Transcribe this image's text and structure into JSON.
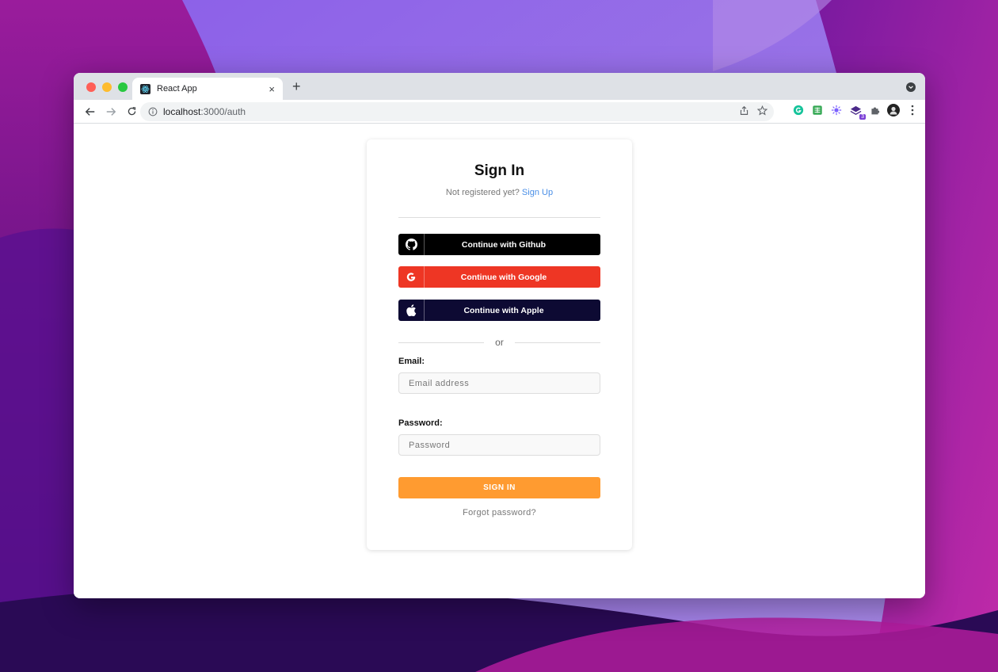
{
  "browser": {
    "tab_title": "React App",
    "tab_close": "×",
    "new_tab": "+",
    "url_host": "localhost",
    "url_path": ":3000/auth",
    "extension_badge": "3"
  },
  "auth": {
    "title": "Sign In",
    "subtitle_prefix": "Not registered yet?",
    "signup_link": "Sign Up",
    "github_label": "Continue with Github",
    "google_label": "Continue with Google",
    "apple_label": "Continue with Apple",
    "divider_text": "or",
    "email_label": "Email:",
    "email_placeholder": "Email address",
    "password_label": "Password:",
    "password_placeholder": "Password",
    "signin_label": "SIGN IN",
    "forgot_label": "Forgot password?"
  },
  "colors": {
    "github": "#000000",
    "google": "#ee3624",
    "apple": "#0d0a33",
    "signin": "#ff9b30",
    "link": "#4a8fe7"
  },
  "icons": {
    "github": "github-icon",
    "google": "google-icon",
    "apple": "apple-icon"
  }
}
